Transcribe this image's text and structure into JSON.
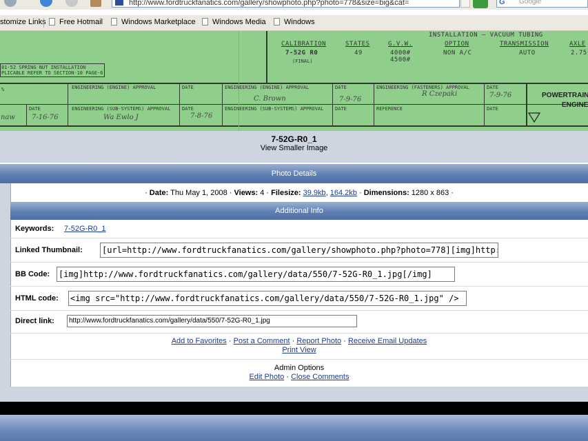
{
  "browser": {
    "url": "http://www.fordtruckfanatics.com/gallery/showphoto.php?photo=778&size=big&cat=",
    "search_placeholder": "Google",
    "search_brand": "G",
    "links_bar": [
      "stomize Links",
      "Free Hotmail",
      "Windows Marketplace",
      "Windows Media",
      "Windows"
    ]
  },
  "photo_label": {
    "calibration_header": "CALIBRATION",
    "calibration_value": "7-52G R0",
    "calibration_note": "(FINAL)",
    "states_header": "STATES",
    "states_value": "49",
    "gvw_header": "G.V.W.",
    "gvw_values": [
      "4000#",
      "4500#"
    ],
    "installation_header": "INSTALLATION — VACUUM TUBING",
    "option_header": "OPTION",
    "option_value": "NON A/C",
    "transmission_header": "TRANSMISSION",
    "transmission_value": "AUTO",
    "axle_header": "AXLE",
    "axle_value": "2.75",
    "note_line1": "81-52 SPRING NUT INSTALLATION",
    "note_line2": "PLICABLE REFER TO SECTION-10 PAGE-6",
    "eng_engine_approval": "ENGINEERING (ENGINE) APPROVAL",
    "eng_engine_approval2": "ENGINEERING (ENGINE) APPROVAL",
    "eng_fasteners_approval": "ENGINEERING (FASTENERS) APPROVAL",
    "eng_subsystems_approval": "ENGINEERING (SUB-SYSTEMS) APPROVAL",
    "eng_subsystems_approval2": "ENGINEERING (SUB-SYSTEMS) APPROVAL",
    "date_label": "DATE",
    "reference_label": "REFERENCE",
    "percent_label": "%",
    "dates_handwritten": [
      "7-16-76",
      "7-8-76",
      "7-9-76",
      "7-9-76"
    ],
    "signatures": [
      "C. Brown",
      "R Czepaki",
      "Wa Ewlo J",
      "naw"
    ],
    "powertrain": "POWERTRAIN A",
    "engine": "ENGINE"
  },
  "caption": {
    "title": "7-52G-R0_1",
    "view_smaller": "View Smaller Image"
  },
  "photo_details": {
    "header": "Photo Details",
    "date_label": "Date:",
    "date_value": "Thu May 1, 2008",
    "views_label": "Views:",
    "views_value": "4",
    "filesize_label": "Filesize:",
    "filesize_small": "39.9kb",
    "filesize_big": "164.2kb",
    "dimensions_label": "Dimensions:",
    "dimensions_value": "1280 x 863"
  },
  "additional_info": {
    "header": "Additional Info",
    "keywords_label": "Keywords:",
    "keywords_value": "7-52G-R0_1",
    "linked_thumbnail_label": "Linked Thumbnail:",
    "linked_thumbnail_value": "[url=http://www.fordtruckfanatics.com/gallery/showphoto.php?photo=778][img]http:/",
    "bbcode_label": "BB Code:",
    "bbcode_value": "[img]http://www.fordtruckfanatics.com/gallery/data/550/7-52G-R0_1.jpg[/img]",
    "htmlcode_label": "HTML code:",
    "htmlcode_value": "<img src=\"http://www.fordtruckfanatics.com/gallery/data/550/7-52G-R0_1.jpg\" />",
    "directlink_label": "Direct link:",
    "directlink_value": "http://www.fordtruckfanatics.com/gallery/data/550/7-52G-R0_1.jpg"
  },
  "actions": {
    "add_favorites": "Add to Favorites",
    "post_comment": "Post a Comment",
    "report_photo": "Report Photo",
    "receive_email": "Receive Email Updates",
    "print_view": "Print View",
    "separator": "·"
  },
  "admin": {
    "title": "Admin Options",
    "edit_photo": "Edit Photo",
    "close_comments": "Close Comments"
  },
  "colors": {
    "header_bar": "#5f7fb3",
    "page_bg": "#cfd5e0",
    "link": "#1a3d8f",
    "label_green": "#8fcf8b"
  }
}
